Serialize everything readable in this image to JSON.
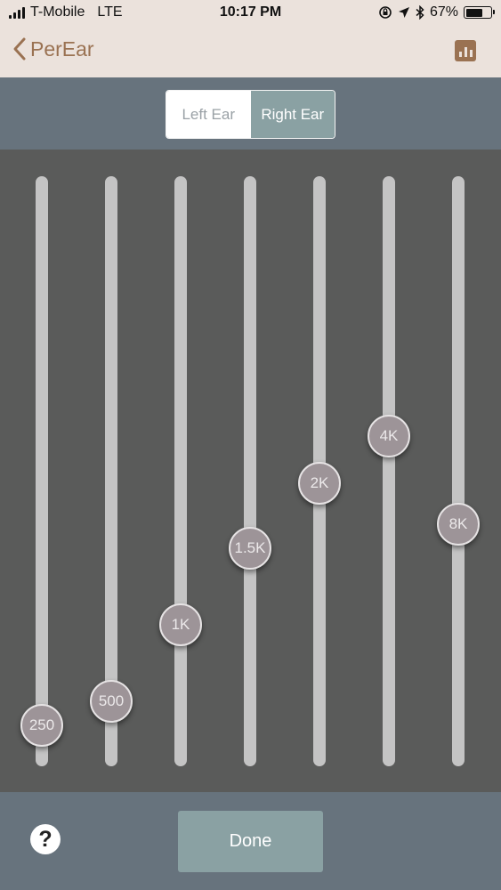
{
  "status_bar": {
    "carrier": "T-Mobile",
    "network": "LTE",
    "time": "10:17 PM",
    "battery_percent": "67%",
    "battery_level": 0.67
  },
  "nav": {
    "back_label": "PerEar",
    "accent_color": "#9a7252"
  },
  "segment": {
    "left_label": "Left Ear",
    "right_label": "Right Ear",
    "selected": "right"
  },
  "equalizer": {
    "bands": [
      {
        "label": "250",
        "level": 0.07
      },
      {
        "label": "500",
        "level": 0.11
      },
      {
        "label": "1K",
        "level": 0.24
      },
      {
        "label": "1.5K",
        "level": 0.37
      },
      {
        "label": "2K",
        "level": 0.48
      },
      {
        "label": "4K",
        "level": 0.56
      },
      {
        "label": "8K",
        "level": 0.41
      }
    ]
  },
  "footer": {
    "help_symbol": "?",
    "done_label": "Done"
  }
}
